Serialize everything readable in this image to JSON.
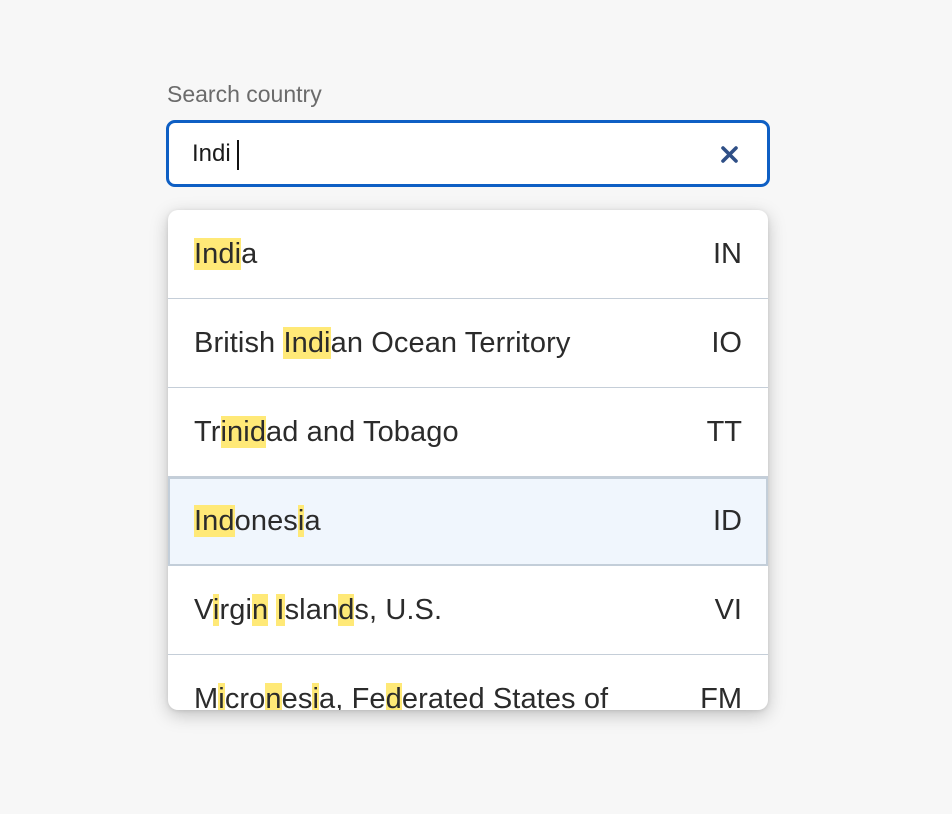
{
  "search": {
    "label": "Search country",
    "value": "Indi",
    "clear_icon": "close-icon"
  },
  "colors": {
    "focus_border": "#0e5fc4",
    "highlight": "#ffe977",
    "active_row": "#f0f6fd"
  },
  "options": [
    {
      "segments": [
        {
          "t": "Indi",
          "h": true
        },
        {
          "t": "a",
          "h": false
        }
      ],
      "code": "IN",
      "active": false
    },
    {
      "segments": [
        {
          "t": "British ",
          "h": false
        },
        {
          "t": "Indi",
          "h": true
        },
        {
          "t": "an Ocean Territory",
          "h": false
        }
      ],
      "code": "IO",
      "active": false
    },
    {
      "segments": [
        {
          "t": "Tr",
          "h": false
        },
        {
          "t": "inid",
          "h": true
        },
        {
          "t": "ad and Tobago",
          "h": false
        }
      ],
      "code": "TT",
      "active": false
    },
    {
      "segments": [
        {
          "t": "Ind",
          "h": true
        },
        {
          "t": "ones",
          "h": false
        },
        {
          "t": "i",
          "h": true
        },
        {
          "t": "a",
          "h": false
        }
      ],
      "code": "ID",
      "active": true
    },
    {
      "segments": [
        {
          "t": "V",
          "h": false
        },
        {
          "t": "i",
          "h": true
        },
        {
          "t": "rgi",
          "h": false
        },
        {
          "t": "n",
          "h": true
        },
        {
          "t": " ",
          "h": false
        },
        {
          "t": "I",
          "h": true
        },
        {
          "t": "slan",
          "h": false
        },
        {
          "t": "d",
          "h": true
        },
        {
          "t": "s, U.S.",
          "h": false
        }
      ],
      "code": "VI",
      "active": false
    },
    {
      "segments": [
        {
          "t": "M",
          "h": false
        },
        {
          "t": "i",
          "h": true
        },
        {
          "t": "cro",
          "h": false
        },
        {
          "t": "n",
          "h": true
        },
        {
          "t": "es",
          "h": false
        },
        {
          "t": "i",
          "h": true
        },
        {
          "t": "a, Fe",
          "h": false
        },
        {
          "t": "d",
          "h": true
        },
        {
          "t": "erated States of",
          "h": false
        }
      ],
      "code": "FM",
      "active": false
    }
  ]
}
